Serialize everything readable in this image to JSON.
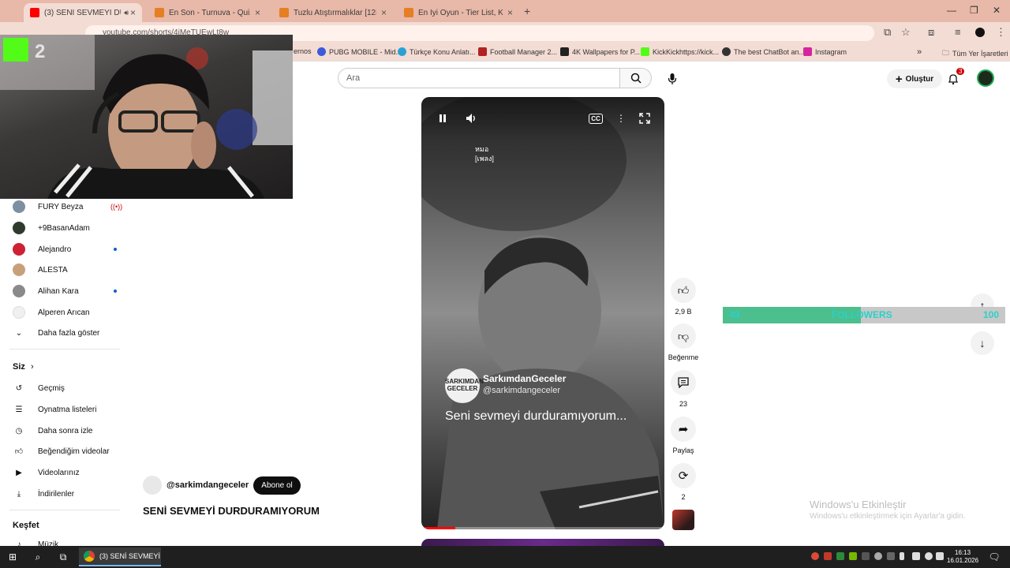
{
  "browser": {
    "tabs": [
      {
        "title": "(3) SENİ SEVMEYİ DURDURAMIYORUM",
        "favicon_color": "#ff0000",
        "active": true
      },
      {
        "title": "En Son - Turnuva - Quizei",
        "favicon_color": "#e67e22",
        "active": false
      },
      {
        "title": "Tuzlu Atıştırmalıklar [128] - Tier",
        "favicon_color": "#e67e22",
        "active": false
      },
      {
        "title": "En İyi Oyun - Tier List, Kör Sırala",
        "favicon_color": "#e67e22",
        "active": false
      }
    ],
    "url": "youtube.com/shorts/4iMeTUEwLt8w",
    "bookmarks": [
      {
        "label": "ernos",
        "color": "#999999"
      },
      {
        "label": "PUBG MOBILE - Mid...",
        "color": "#3b5bdb"
      },
      {
        "label": "Türkçe Konu Anlatı...",
        "color": "#2aa1d3"
      },
      {
        "label": "Football Manager 2...",
        "color": "#b22222"
      },
      {
        "label": "4K Wallpapers for P...",
        "color": "#222222"
      },
      {
        "label": "KickKickhttps://kick...",
        "color": "#53fc18"
      },
      {
        "label": "The best ChatBot an...",
        "color": "#333333"
      },
      {
        "label": "Instagram",
        "color": "#d6249f"
      }
    ],
    "all_bookmarks": "Tüm Yer İşaretleri"
  },
  "overlay": {
    "kick_number": "2"
  },
  "header": {
    "search_placeholder": "Ara",
    "create_label": "Oluştur",
    "notification_count": "3"
  },
  "sidebar": {
    "subscriptions": [
      {
        "name": "FURY Beyza",
        "avatar": "#7d8fa3",
        "live": true,
        "dot": false
      },
      {
        "name": "+9BasanAdam",
        "avatar": "#2e3b2e",
        "live": false,
        "dot": false
      },
      {
        "name": "Alejandro",
        "avatar": "#cc2233",
        "live": false,
        "dot": true
      },
      {
        "name": "ALESTA",
        "avatar": "#c7a07a",
        "live": false,
        "dot": false
      },
      {
        "name": "Alihan Kara",
        "avatar": "#8a8a8a",
        "live": false,
        "dot": true
      },
      {
        "name": "Alperen Arıcan",
        "avatar": "#f0f0f0",
        "live": false,
        "dot": false
      }
    ],
    "show_more": "Daha fazla göster",
    "you_heading": "Siz",
    "you_items": [
      {
        "label": "Geçmiş",
        "icon": "history-icon"
      },
      {
        "label": "Oynatma listeleri",
        "icon": "playlist-icon"
      },
      {
        "label": "Daha sonra izle",
        "icon": "clock-icon"
      },
      {
        "label": "Beğendiğim videolar",
        "icon": "thumb-up-icon"
      },
      {
        "label": "Videolarınız",
        "icon": "video-icon"
      },
      {
        "label": "İndirilenler",
        "icon": "download-icon"
      }
    ],
    "explore_heading": "Keşfet",
    "explore_items": [
      {
        "label": "Müzik",
        "icon": "music-icon"
      }
    ]
  },
  "video": {
    "subtitle_lines": [
      "หมอ",
      "[เพลง]"
    ],
    "channel_badge": "SARKIMDAN GECELER",
    "channel_name": "SarkımdanGeceler",
    "channel_handle": "@sarkimdangeceler",
    "lyric": "Seni sevmeyi durduramıyorum...",
    "cc_label": "CC",
    "progress": 0.14
  },
  "actions": {
    "likes": "2,9 B",
    "dislike": "Beğenme",
    "comments": "23",
    "share": "Paylaş",
    "remix": "2"
  },
  "channel": {
    "handle": "@sarkimdangeceler",
    "subscribe": "Abone ol",
    "title": "SENİ SEVMEYİ DURDURAMIYORUM"
  },
  "followers": {
    "current": "49",
    "label": "FOLLOWERS",
    "goal": "100",
    "progress": 0.49
  },
  "windows_watermark": {
    "line1": "Windows'u Etkinleştir",
    "line2": "Windows'u etkinleştirmek için Ayarlar'a gidin."
  },
  "taskbar": {
    "app_label": "(3) SENİ SEVMEYİ D...",
    "time": "16:13",
    "date": "16.01.2026"
  }
}
